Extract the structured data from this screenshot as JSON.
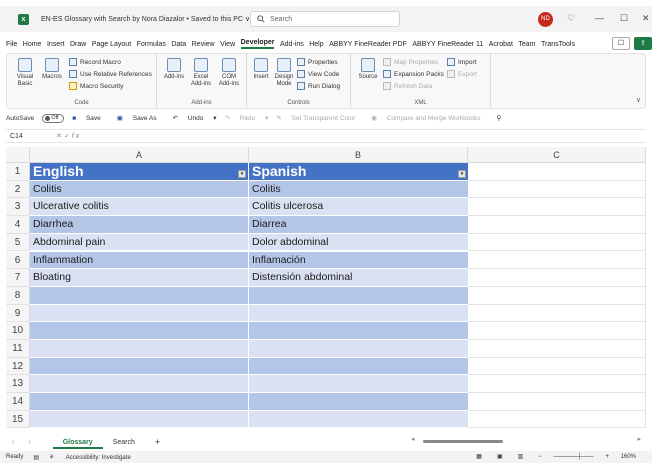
{
  "window": {
    "title": "EN-ES Glossary with Search by Nora Diazalor • Saved to this PC ∨",
    "search_placeholder": "Search",
    "avatar_initials": "ND"
  },
  "menu": [
    "File",
    "Home",
    "Insert",
    "Draw",
    "Page Layout",
    "Formulas",
    "Data",
    "Review",
    "View",
    "Developer",
    "Add-ins",
    "Help",
    "ABBYY FineReader PDF",
    "ABBYY FineReader 11",
    "Acrobat",
    "Team",
    "TransTools"
  ],
  "ribbon": {
    "code": {
      "label": "Code",
      "visual_basic": "Visual Basic",
      "macros": "Macros",
      "record_macro": "Record Macro",
      "relative_refs": "Use Relative References",
      "macro_security": "Macro Security"
    },
    "addins": {
      "label": "Add-ins",
      "addins": "Add-ins",
      "excel_addins": "Excel Add-ins",
      "com_addins": "COM Add-ins"
    },
    "controls": {
      "label": "Controls",
      "insert": "Insert",
      "design_mode": "Design Mode",
      "properties": "Properties",
      "view_code": "View Code",
      "run_dialog": "Run Dialog"
    },
    "xml": {
      "label": "XML",
      "source": "Source",
      "map_properties": "Map Properties",
      "expansion_packs": "Expansion Packs",
      "refresh_data": "Refresh Data",
      "import": "Import",
      "export": "Export"
    }
  },
  "qat": {
    "autosave": "AutoSave",
    "autosave_state": "Off",
    "save": "Save",
    "save_as": "Save As",
    "undo": "Undo",
    "redo": "Redo",
    "set_transparent": "Set Transparent Color",
    "compare_merge": "Compare and Merge Workbooks"
  },
  "formula_bar": {
    "name_box": "C14",
    "fx": "fx"
  },
  "columns": [
    "A",
    "B",
    "C"
  ],
  "table": {
    "headers": [
      "English",
      "Spanish"
    ],
    "rows": [
      [
        "Colitis",
        "Colitis"
      ],
      [
        "Ulcerative colitis",
        "Colitis ulcerosa"
      ],
      [
        "Diarrhea",
        "Diarrea"
      ],
      [
        "Abdominal pain",
        "Dolor abdominal"
      ],
      [
        "Inflammation",
        "Inflamación"
      ],
      [
        "Bloating",
        "Distensión abdominal"
      ],
      [
        "",
        ""
      ],
      [
        "",
        ""
      ],
      [
        "",
        ""
      ],
      [
        "",
        ""
      ],
      [
        "",
        ""
      ],
      [
        "",
        ""
      ],
      [
        "",
        ""
      ],
      [
        "",
        ""
      ]
    ],
    "row_numbers": [
      "1",
      "2",
      "3",
      "4",
      "5",
      "6",
      "7",
      "8",
      "9",
      "10",
      "11",
      "12",
      "13",
      "14",
      "15"
    ]
  },
  "sheets": {
    "tabs": [
      "Glossary",
      "Search"
    ],
    "active": "Glossary",
    "add": "+"
  },
  "status": {
    "ready": "Ready",
    "accessibility": "Accessibility: Investigate",
    "zoom": "160%"
  }
}
